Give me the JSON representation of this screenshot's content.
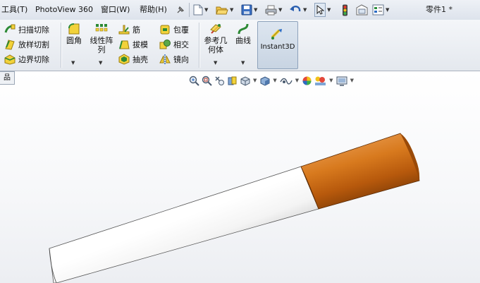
{
  "menu": {
    "tools": "工具(T)",
    "photoview": "PhotoView 360",
    "window": "窗口(W)",
    "help": "帮助(H)"
  },
  "title": "零件1 *",
  "ribbon": {
    "sweep_cut": "扫描切除",
    "loft_cut": "放样切割",
    "boundary_cut": "边界切除",
    "fillet": "圆角",
    "linear_pattern": "线性阵列",
    "rib": "筋",
    "draft": "拔模",
    "shell": "抽壳",
    "wrap": "包覆",
    "intersect": "相交",
    "mirror": "镜向",
    "ref_geometry": "参考几何体",
    "curves": "曲线",
    "instant3d": "Instant3D"
  },
  "tree_tab": "品",
  "icons": [
    "sweep-cut-icon",
    "loft-cut-icon",
    "boundary-cut-icon",
    "fillet-icon",
    "linear-pattern-icon",
    "rib-icon",
    "draft-icon",
    "shell-icon",
    "wrap-icon",
    "intersect-icon",
    "mirror-icon",
    "reference-geometry-icon",
    "curves-icon",
    "instant3d-icon",
    "new-document-icon",
    "open-icon",
    "save-icon",
    "print-icon",
    "undo-icon",
    "select-icon",
    "rebuild-icon",
    "file-properties-icon",
    "options-icon",
    "zoom-to-fit-icon",
    "zoom-area-icon",
    "previous-view-icon",
    "section-view-icon",
    "view-orientation-icon",
    "display-style-icon",
    "hide-show-icon",
    "appearance-icon",
    "scene-icon",
    "view-settings-icon"
  ],
  "colors": {
    "cylinder_white": "#f2f2f2",
    "cylinder_orange": "#c8640c",
    "accent": "#2b6cc4"
  }
}
